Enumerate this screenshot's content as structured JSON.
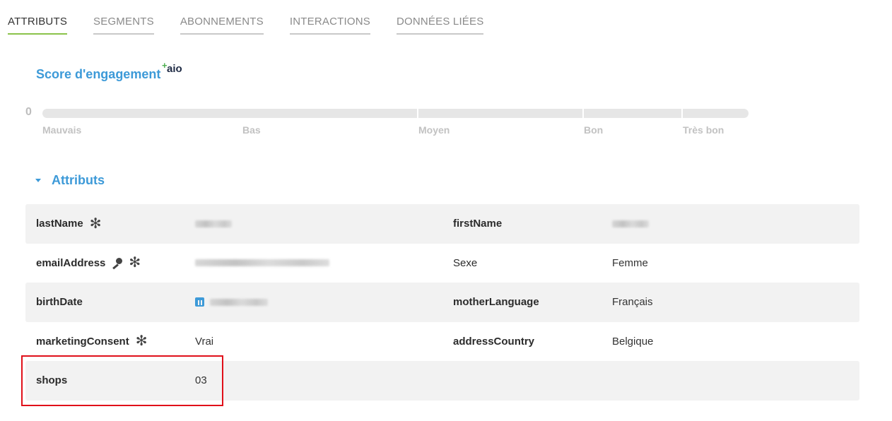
{
  "tabs": [
    {
      "label": "ATTRIBUTS",
      "active": true
    },
    {
      "label": "SEGMENTS",
      "active": false
    },
    {
      "label": "ABONNEMENTS",
      "active": false
    },
    {
      "label": "INTERACTIONS",
      "active": false
    },
    {
      "label": "DONNÉES LIÉES",
      "active": false
    }
  ],
  "engagement": {
    "title": "Score d'engagement",
    "badge_plus": "+",
    "badge_text": "aio",
    "value": "0",
    "labels": [
      "Mauvais",
      "Bas",
      "Moyen",
      "Bon",
      "Très bon"
    ]
  },
  "section": {
    "title": "Attributs",
    "expanded": true
  },
  "attributes": {
    "lastName": {
      "key": "lastName",
      "required": true,
      "value_hidden": true
    },
    "firstName": {
      "key": "firstName",
      "value_hidden": true
    },
    "emailAddress": {
      "key": "emailAddress",
      "is_key": true,
      "required": true,
      "value_hidden": true
    },
    "sexe": {
      "key": "Sexe",
      "value": "Femme"
    },
    "birthDate": {
      "key": "birthDate",
      "value_hidden": true,
      "icon": "calendar-icon"
    },
    "motherLanguage": {
      "key": "motherLanguage",
      "value": "Français"
    },
    "marketingConsent": {
      "key": "marketingConsent",
      "required": true,
      "value": "Vrai"
    },
    "addressCountry": {
      "key": "addressCountry",
      "value": "Belgique"
    },
    "shops": {
      "key": "shops",
      "value": "03"
    }
  },
  "colors": {
    "accent_blue": "#3d9ad8",
    "active_tab_underline": "#8bc34a",
    "highlight_red": "#e0101a",
    "row_shade": "#f2f2f2"
  }
}
